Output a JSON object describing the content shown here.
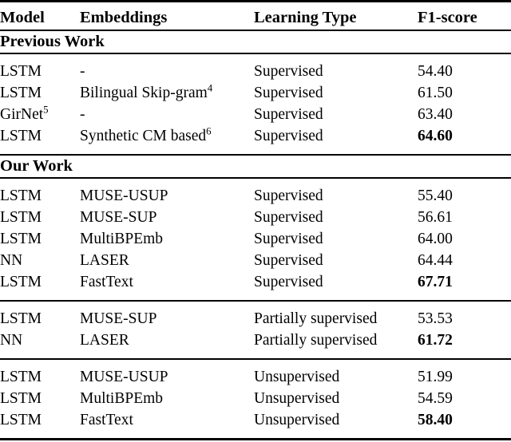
{
  "table": {
    "columns": [
      {
        "key": "model",
        "label": "Model"
      },
      {
        "key": "embeddings",
        "label": "Embeddings"
      },
      {
        "key": "learning_type",
        "label": "Learning Type"
      },
      {
        "key": "f1",
        "label": "F1-score"
      }
    ],
    "sections": [
      {
        "title": "Previous Work",
        "groups": [
          {
            "rows": [
              {
                "model": "LSTM",
                "model_sup": "",
                "embeddings": "-",
                "emb_sup": "",
                "learning_type": "Supervised",
                "f1": "54.40",
                "f1_bold": false
              },
              {
                "model": "LSTM",
                "model_sup": "",
                "embeddings": "Bilingual Skip-gram",
                "emb_sup": "4",
                "learning_type": "Supervised",
                "f1": "61.50",
                "f1_bold": false
              },
              {
                "model": "GirNet",
                "model_sup": "5",
                "embeddings": "-",
                "emb_sup": "",
                "learning_type": "Supervised",
                "f1": "63.40",
                "f1_bold": false
              },
              {
                "model": "LSTM",
                "model_sup": "",
                "embeddings": "Synthetic CM based",
                "emb_sup": "6",
                "learning_type": "Supervised",
                "f1": "64.60",
                "f1_bold": true
              }
            ]
          }
        ]
      },
      {
        "title": "Our Work",
        "groups": [
          {
            "rows": [
              {
                "model": "LSTM",
                "model_sup": "",
                "embeddings": "MUSE-USUP",
                "emb_sup": "",
                "learning_type": "Supervised",
                "f1": "55.40",
                "f1_bold": false
              },
              {
                "model": "LSTM",
                "model_sup": "",
                "embeddings": "MUSE-SUP",
                "emb_sup": "",
                "learning_type": "Supervised",
                "f1": "56.61",
                "f1_bold": false
              },
              {
                "model": "LSTM",
                "model_sup": "",
                "embeddings": "MultiBPEmb",
                "emb_sup": "",
                "learning_type": "Supervised",
                "f1": "64.00",
                "f1_bold": false
              },
              {
                "model": "NN",
                "model_sup": "",
                "embeddings": "LASER",
                "emb_sup": "",
                "learning_type": "Supervised",
                "f1": "64.44",
                "f1_bold": false
              },
              {
                "model": "LSTM",
                "model_sup": "",
                "embeddings": "FastText",
                "emb_sup": "",
                "learning_type": "Supervised",
                "f1": "67.71",
                "f1_bold": true
              }
            ]
          },
          {
            "rows": [
              {
                "model": "LSTM",
                "model_sup": "",
                "embeddings": "MUSE-SUP",
                "emb_sup": "",
                "learning_type": "Partially supervised",
                "f1": "53.53",
                "f1_bold": false
              },
              {
                "model": "NN",
                "model_sup": "",
                "embeddings": "LASER",
                "emb_sup": "",
                "learning_type": "Partially supervised",
                "f1": "61.72",
                "f1_bold": true
              }
            ]
          },
          {
            "rows": [
              {
                "model": "LSTM",
                "model_sup": "",
                "embeddings": "MUSE-USUP",
                "emb_sup": "",
                "learning_type": "Unsupervised",
                "f1": "51.99",
                "f1_bold": false
              },
              {
                "model": "LSTM",
                "model_sup": "",
                "embeddings": "MultiBPEmb",
                "emb_sup": "",
                "learning_type": "Unsupervised",
                "f1": "54.59",
                "f1_bold": false
              },
              {
                "model": "LSTM",
                "model_sup": "",
                "embeddings": "FastText",
                "emb_sup": "",
                "learning_type": "Unsupervised",
                "f1": "58.40",
                "f1_bold": true
              }
            ]
          }
        ]
      }
    ]
  }
}
